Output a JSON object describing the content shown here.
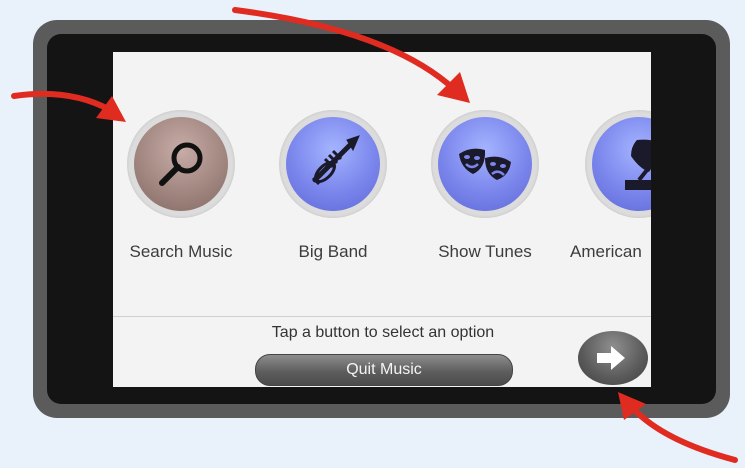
{
  "categories": [
    {
      "label": "Search Music",
      "icon": "magnifier-icon",
      "color": "#a28680"
    },
    {
      "label": "Big Band",
      "icon": "trumpet-icon",
      "color": "#7b86ec"
    },
    {
      "label": "Show Tunes",
      "icon": "theater-masks-icon",
      "color": "#7b86ec"
    },
    {
      "label": "American",
      "icon": "gramophone-icon",
      "color": "#7b86ec"
    }
  ],
  "footer": {
    "hint": "Tap a button to select an option",
    "quit_label": "Quit Music",
    "next_icon": "arrow-right-icon"
  },
  "annotations": {
    "arrow_color": "#e02b20"
  }
}
